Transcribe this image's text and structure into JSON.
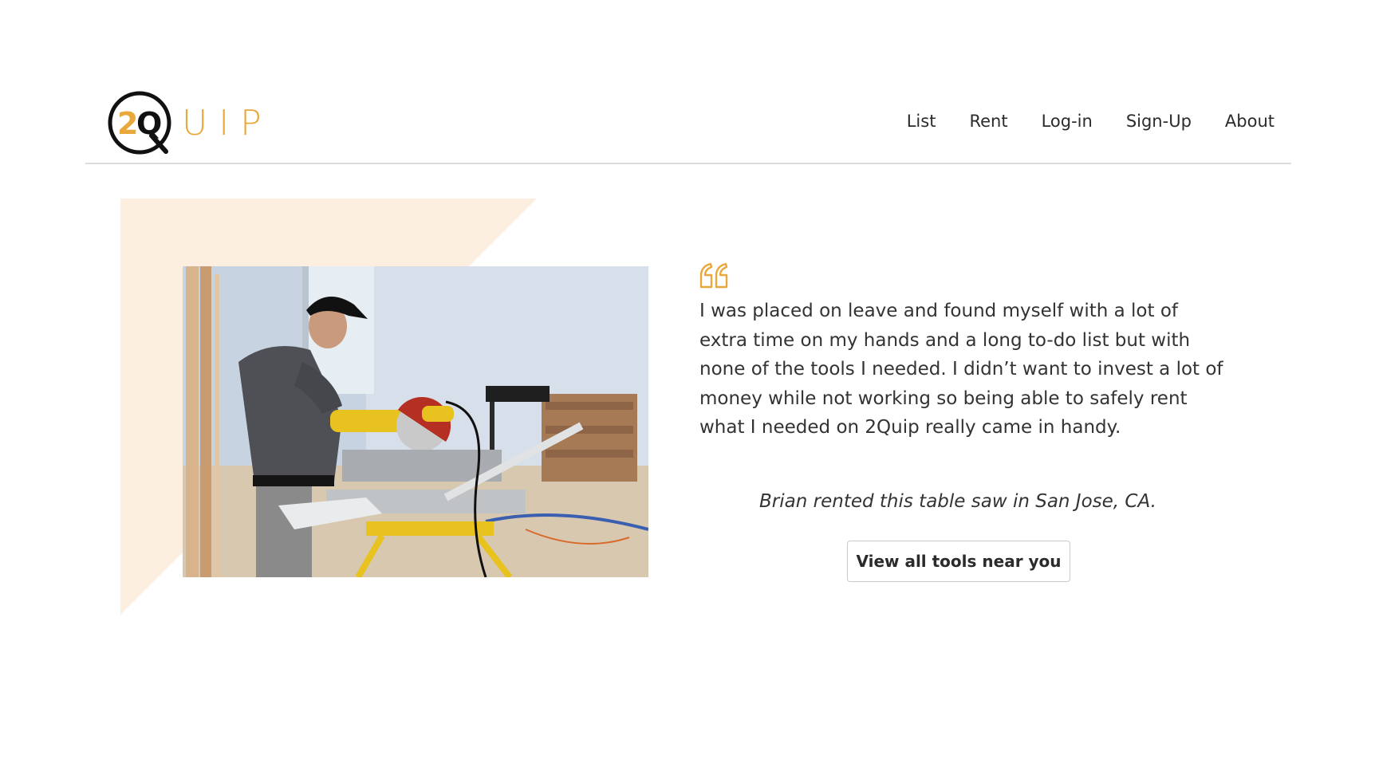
{
  "brand": {
    "mark_text": "2",
    "mark_letter": "Q",
    "wordmark": "UIP",
    "accent_color": "#e9a83c"
  },
  "nav": {
    "items": [
      {
        "label": "List"
      },
      {
        "label": "Rent"
      },
      {
        "label": "Log-in"
      },
      {
        "label": "Sign-Up"
      },
      {
        "label": "About"
      }
    ]
  },
  "hero": {
    "image_icon": "photo-man-using-miter-saw",
    "quote_icon": "quote-mark-icon",
    "testimonial": "I was placed on leave and found myself with a lot of extra time on my hands and a long to-do list but with none of the tools I needed. I didn’t want to invest a lot of money while not working so being able to safely rent what I needed on 2Quip really came in handy.",
    "attribution": "Brian rented this table saw in San Jose, CA.",
    "cta_label": "View all tools near you",
    "triangle_color": "#fcefdf"
  }
}
